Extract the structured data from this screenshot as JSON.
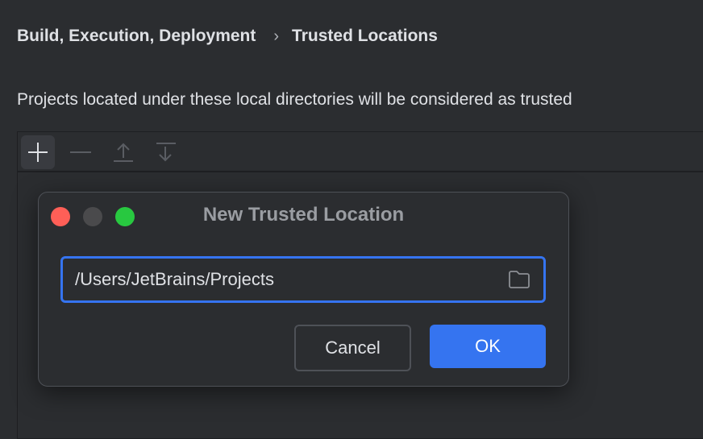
{
  "breadcrumb": {
    "parent": "Build, Execution, Deployment",
    "separator": "›",
    "current": "Trusted Locations"
  },
  "description": "Projects located under these local directories will be considered as trusted",
  "toolbar": {
    "icons": [
      "plus-icon",
      "minus-icon",
      "move-up-icon",
      "move-down-icon"
    ]
  },
  "dialog": {
    "title": "New Trusted Location",
    "path_value": "/Users/JetBrains/Projects",
    "cancel_label": "Cancel",
    "ok_label": "OK"
  },
  "colors": {
    "accent": "#3574f0",
    "close": "#ff5f57",
    "minimize": "#4a4a4c",
    "zoom": "#28c840",
    "background": "#2b2d30"
  }
}
